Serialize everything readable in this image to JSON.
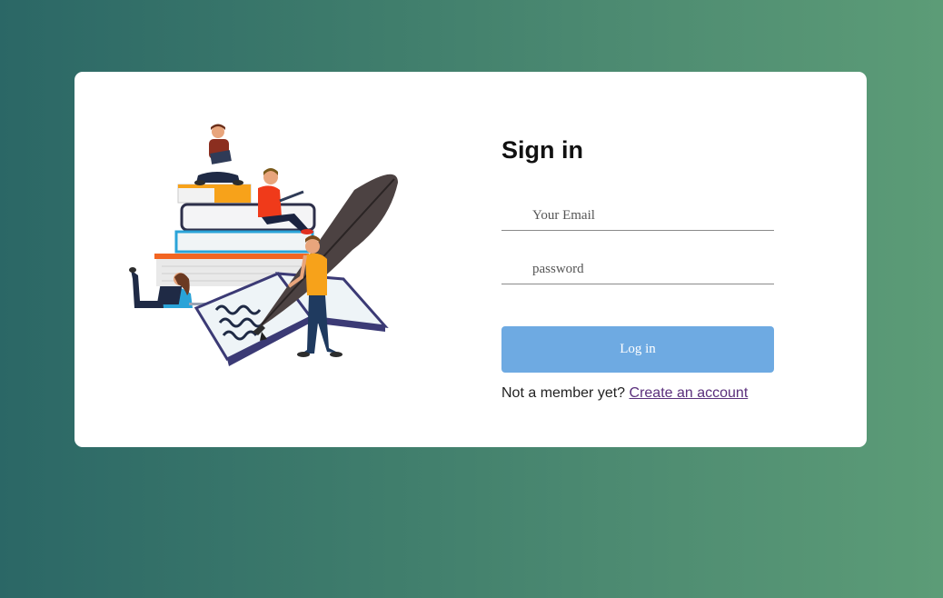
{
  "login": {
    "title": "Sign in",
    "email_placeholder": "Your Email",
    "password_placeholder": "password",
    "submit_label": "Log in",
    "signup_prompt": "Not a member yet?",
    "signup_link": "Create an account"
  },
  "illustration": {
    "icon": "people-reading-books-illustration"
  },
  "colors": {
    "background_start": "#2b6766",
    "background_end": "#5c9c77",
    "button": "#6eaae2",
    "link": "#5a2f7c"
  }
}
